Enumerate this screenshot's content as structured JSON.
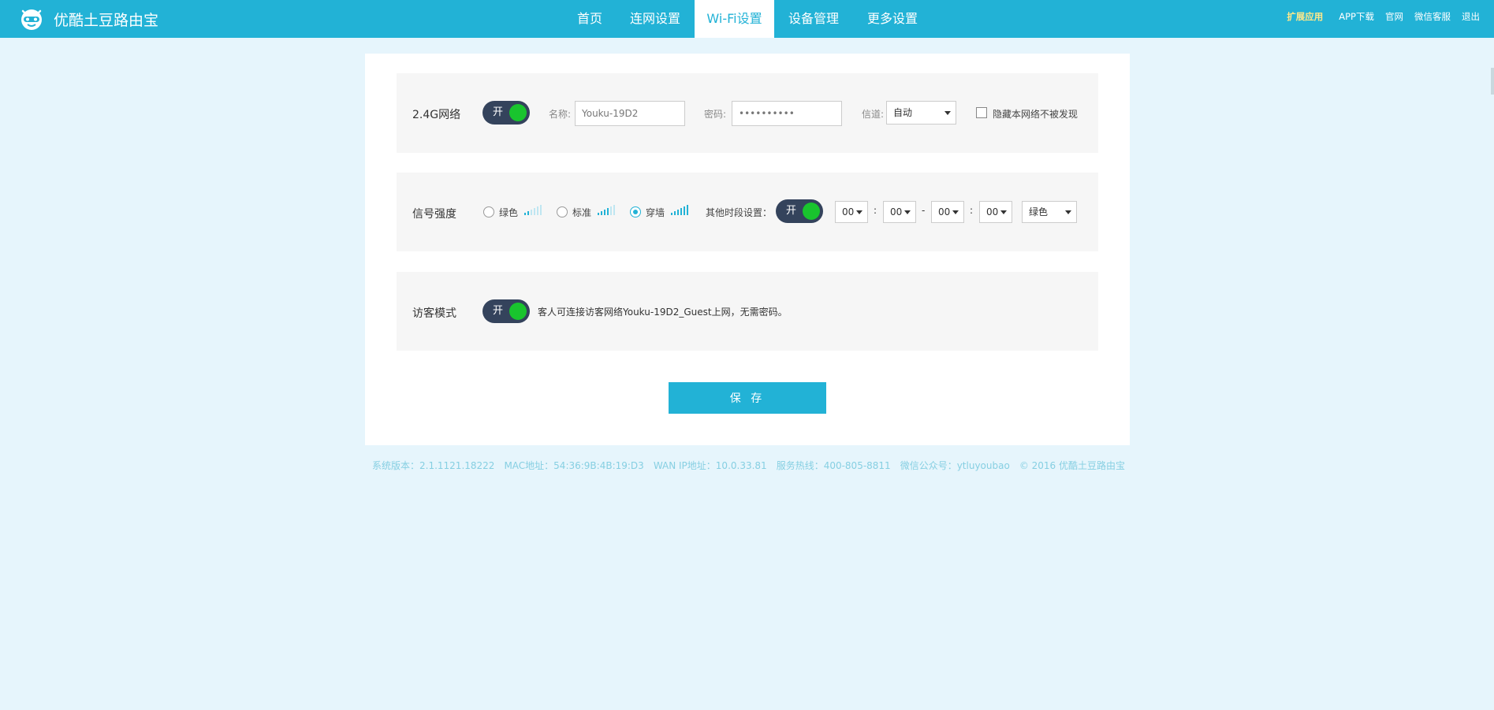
{
  "header": {
    "brand": "优酷土豆路由宝",
    "nav": [
      {
        "label": "首页",
        "active": false
      },
      {
        "label": "连网设置",
        "active": false
      },
      {
        "label": "Wi-Fi设置",
        "active": true
      },
      {
        "label": "设备管理",
        "active": false
      },
      {
        "label": "更多设置",
        "active": false
      }
    ],
    "links": [
      "扩展应用",
      "APP下载",
      "官网",
      "微信客服",
      "退出"
    ]
  },
  "wifi24": {
    "label": "2.4G网络",
    "toggle": "开",
    "name_label": "名称:",
    "name_value": "Youku-19D2",
    "password_label": "密码:",
    "password_value": "••••••••••",
    "channel_label": "信道:",
    "channel_value": "自动",
    "hide_label": "隐藏本网络不被发现"
  },
  "signal": {
    "label": "信号强度",
    "options": [
      {
        "label": "绿色",
        "selected": false,
        "level": 2
      },
      {
        "label": "标准",
        "selected": false,
        "level": 4
      },
      {
        "label": "穿墙",
        "selected": true,
        "level": 6
      }
    ],
    "other_time_label": "其他时段设置：",
    "toggle": "开",
    "times": [
      "00",
      "00",
      "00",
      "00"
    ],
    "colon": ":",
    "dash": "-",
    "mode": "绿色"
  },
  "guest": {
    "label": "访客模式",
    "toggle": "开",
    "description": "客人可连接访客网络Youku-19D2_Guest上网，无需密码。"
  },
  "save_label": "保 存",
  "footer": {
    "version": "系统版本：2.1.1121.18222",
    "mac": "MAC地址：54:36:9B:4B:19:D3",
    "wan": "WAN IP地址：10.0.33.81",
    "hotline": "服务热线：400-805-8811",
    "wechat": "微信公众号：ytluyoubao",
    "copyright": "© 2016 优酷土豆路由宝"
  },
  "colors": {
    "brand": "#22b2d6",
    "toggle_bg": "#34435c",
    "toggle_knob": "#19c42e",
    "page_bg": "#e6f5fc"
  }
}
